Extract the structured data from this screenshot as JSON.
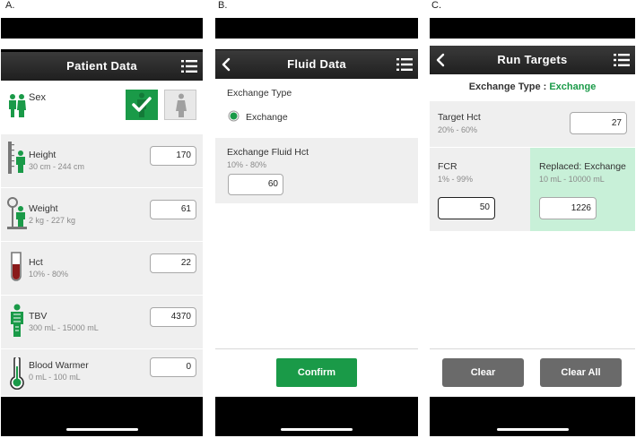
{
  "panels": {
    "a": {
      "label": "A.",
      "title": "Patient Data",
      "sex_label": "Sex",
      "rows": [
        {
          "label": "Height",
          "range": "30 cm - 244 cm",
          "value": "170"
        },
        {
          "label": "Weight",
          "range": "2 kg - 227 kg",
          "value": "61"
        },
        {
          "label": "Hct",
          "range": "10% - 80%",
          "value": "22"
        },
        {
          "label": "TBV",
          "range": "300 mL - 15000 mL",
          "value": "4370"
        },
        {
          "label": "Blood Warmer",
          "range": "0 mL - 100 mL",
          "value": "0"
        }
      ]
    },
    "b": {
      "label": "B.",
      "title": "Fluid Data",
      "exchange_type_label": "Exchange Type",
      "exchange_option": "Exchange",
      "fluid_hct_label": "Exchange Fluid Hct",
      "fluid_hct_range": "10% - 80%",
      "fluid_hct_value": "60",
      "confirm_label": "Confirm"
    },
    "c": {
      "label": "C.",
      "title": "Run Targets",
      "exchange_type_prefix": "Exchange Type : ",
      "exchange_type_value": "Exchange",
      "target_hct_label": "Target Hct",
      "target_hct_range": "20% - 60%",
      "target_hct_value": "27",
      "fcr_label": "FCR",
      "fcr_range": "1% - 99%",
      "fcr_value": "50",
      "replaced_label": "Replaced: Exchange",
      "replaced_range": "10 mL - 10000 mL",
      "replaced_value": "1226",
      "clear_label": "Clear",
      "clear_all_label": "Clear All"
    }
  },
  "colors": {
    "accent_green": "#1a9a48",
    "highlight_green": "#c8f0d8",
    "titlebar": "#2a2a2a",
    "button_gray": "#6a6a6a"
  },
  "icons": [
    "menu-icon",
    "back-icon",
    "person-pair-icon",
    "check-icon",
    "female-icon",
    "height-icon",
    "scale-icon",
    "test-tube-icon",
    "body-icon",
    "thermometer-icon",
    "radio-selected-icon"
  ]
}
